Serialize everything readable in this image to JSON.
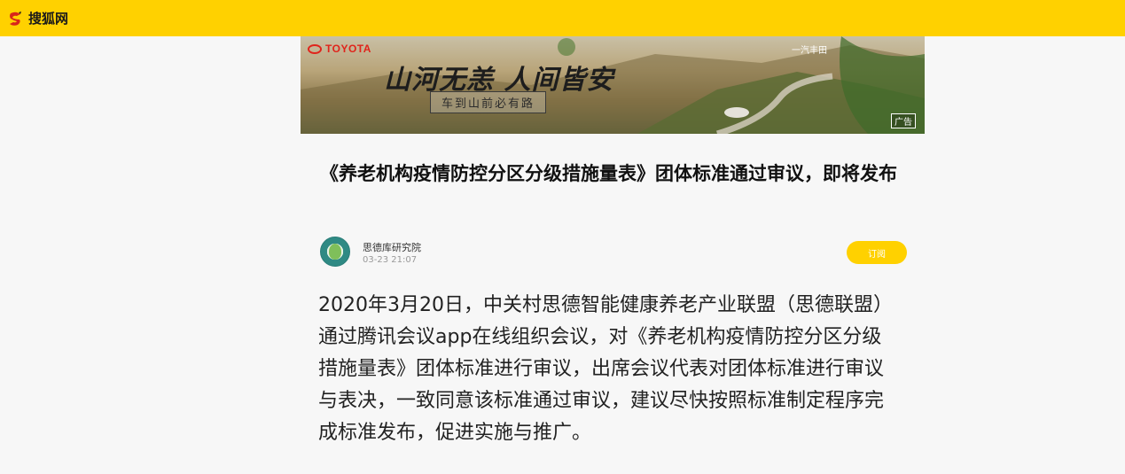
{
  "header": {
    "site_name": "搜狐网",
    "logo_icon": "sohu-fox-icon",
    "background": "#ffd100"
  },
  "ad": {
    "brand": "TOYOTA",
    "brand_right": "一汽丰田",
    "slogan": "山河无恙 人间皆安",
    "subline": "车到山前必有路",
    "tag": "广告"
  },
  "article": {
    "title": "《养老机构疫情防控分区分级措施量表》团体标准通过审议，即将发布",
    "author": "思德库研究院",
    "time": "03-23 21:07",
    "subscribe_label": "订阅",
    "body": "2020年3月20日，中关村思德智能健康养老产业联盟（思德联盟）通过腾讯会议app在线组织会议，对《养老机构疫情防控分区分级措施量表》团体标准进行审议，出席会议代表对团体标准进行审议与表决，一致同意该标准通过审议，建议尽快按照标准制定程序完成标准发布，促进实施与推广。"
  },
  "colors": {
    "accent": "#ffd100",
    "page_bg": "#f7f7f7",
    "toyota_red": "#e0241b"
  }
}
